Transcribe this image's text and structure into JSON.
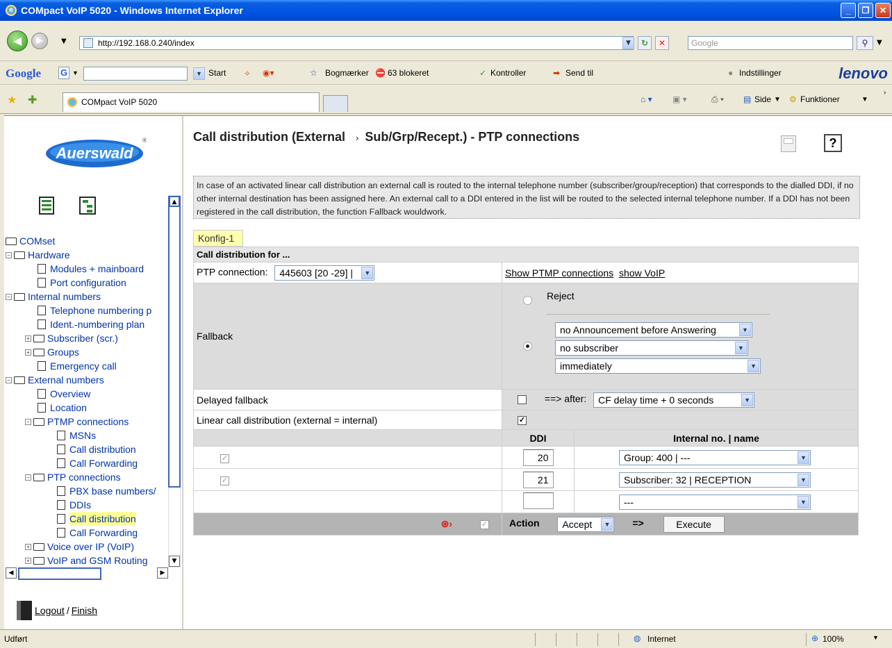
{
  "window": {
    "title": "COMpact VoIP 5020 - Windows Internet Explorer"
  },
  "address": {
    "url": "http://192.168.0.240/index",
    "search_placeholder": "Google"
  },
  "google_toolbar": {
    "logo": "Google",
    "g_button": "G",
    "items": [
      "Start",
      "Bogmærker",
      "63 blokeret",
      "Kontroller",
      "Send til",
      "Indstillinger"
    ],
    "brand": "lenovo"
  },
  "tabs": {
    "active_tab": "COMpact VoIP 5020",
    "side_label": "Side",
    "tools_label": "Funktioner"
  },
  "sidebar": {
    "logo": "Auerswald",
    "root": "COMset",
    "items": [
      {
        "label": "Hardware",
        "type": "folder",
        "level": 1
      },
      {
        "label": "Modules + mainboard",
        "type": "doc",
        "level": 2
      },
      {
        "label": "Port configuration",
        "type": "doc",
        "level": 2
      },
      {
        "label": "Internal numbers",
        "type": "folder",
        "level": 1
      },
      {
        "label": "Telephone numbering p",
        "type": "doc",
        "level": 2
      },
      {
        "label": "Ident.-numbering plan",
        "type": "doc",
        "level": 2
      },
      {
        "label": "Subscriber (scr.)",
        "type": "folder",
        "level": 2
      },
      {
        "label": "Groups",
        "type": "folder",
        "level": 2
      },
      {
        "label": "Emergency call",
        "type": "doc",
        "level": 2
      },
      {
        "label": "External numbers",
        "type": "folder",
        "level": 1
      },
      {
        "label": "Overview",
        "type": "doc",
        "level": 2
      },
      {
        "label": "Location",
        "type": "doc",
        "level": 2
      },
      {
        "label": "PTMP connections",
        "type": "folder",
        "level": 2
      },
      {
        "label": "MSNs",
        "type": "doc",
        "level": 3
      },
      {
        "label": "Call distribution",
        "type": "doc",
        "level": 3
      },
      {
        "label": "Call Forwarding",
        "type": "doc",
        "level": 3
      },
      {
        "label": "PTP connections",
        "type": "folder",
        "level": 2
      },
      {
        "label": "PBX base numbers/",
        "type": "doc",
        "level": 3
      },
      {
        "label": "DDIs",
        "type": "doc",
        "level": 3
      },
      {
        "label": "Call distribution",
        "type": "doc",
        "level": 3,
        "selected": true
      },
      {
        "label": "Call Forwarding",
        "type": "doc",
        "level": 3
      },
      {
        "label": "Voice over IP (VoIP)",
        "type": "folder",
        "level": 2
      },
      {
        "label": "VoIP and GSM Routing",
        "type": "folder",
        "level": 2
      }
    ],
    "logout": "Logout",
    "finish": "Finish"
  },
  "page": {
    "title_part1": "Call distribution (External",
    "title_part2": "Sub/Grp/Recept.) - PTP connections",
    "help": "?",
    "description": "In case of an activated linear call distribution an external call is routed to the internal telephone number (subscriber/group/reception) that corresponds to the dialled DDI, if no other internal destination has been assigned here. An external call to a DDI entered in the list will be routed to the selected internal telephone number. If a DDI has not been registered in the call distribution, the function Fallback wouldwork.",
    "config_tab": "Konfig-1",
    "section_header": "Call distribution for ...",
    "ptp_label": "PTP connection:",
    "ptp_value": "445603 [20 -29] |",
    "show_ptmp": "Show PTMP connections",
    "show_voip": "show VoIP",
    "fallback_label": "Fallback",
    "reject_label": "Reject",
    "announcement": "no Announcement before Answering",
    "subscriber": "no subscriber",
    "timing": "immediately",
    "delayed_label": "Delayed fallback",
    "after_label": "==> after:",
    "delay_value": "CF delay time + 0 seconds",
    "linear_label": "Linear call distribution (external = internal)",
    "col_ddi": "DDI",
    "col_internal": "Internal no. | name",
    "rows": [
      {
        "ddi": "20",
        "target": "Group: 400 | ---"
      },
      {
        "ddi": "21",
        "target": "Subscriber: 32 | RECEPTION"
      },
      {
        "ddi": "",
        "target": "---"
      }
    ],
    "action_label": "Action",
    "action_value": "Accept",
    "arrow": "=>",
    "execute": "Execute"
  },
  "status": {
    "left": "Udført",
    "zone": "Internet",
    "zoom": "100%"
  }
}
